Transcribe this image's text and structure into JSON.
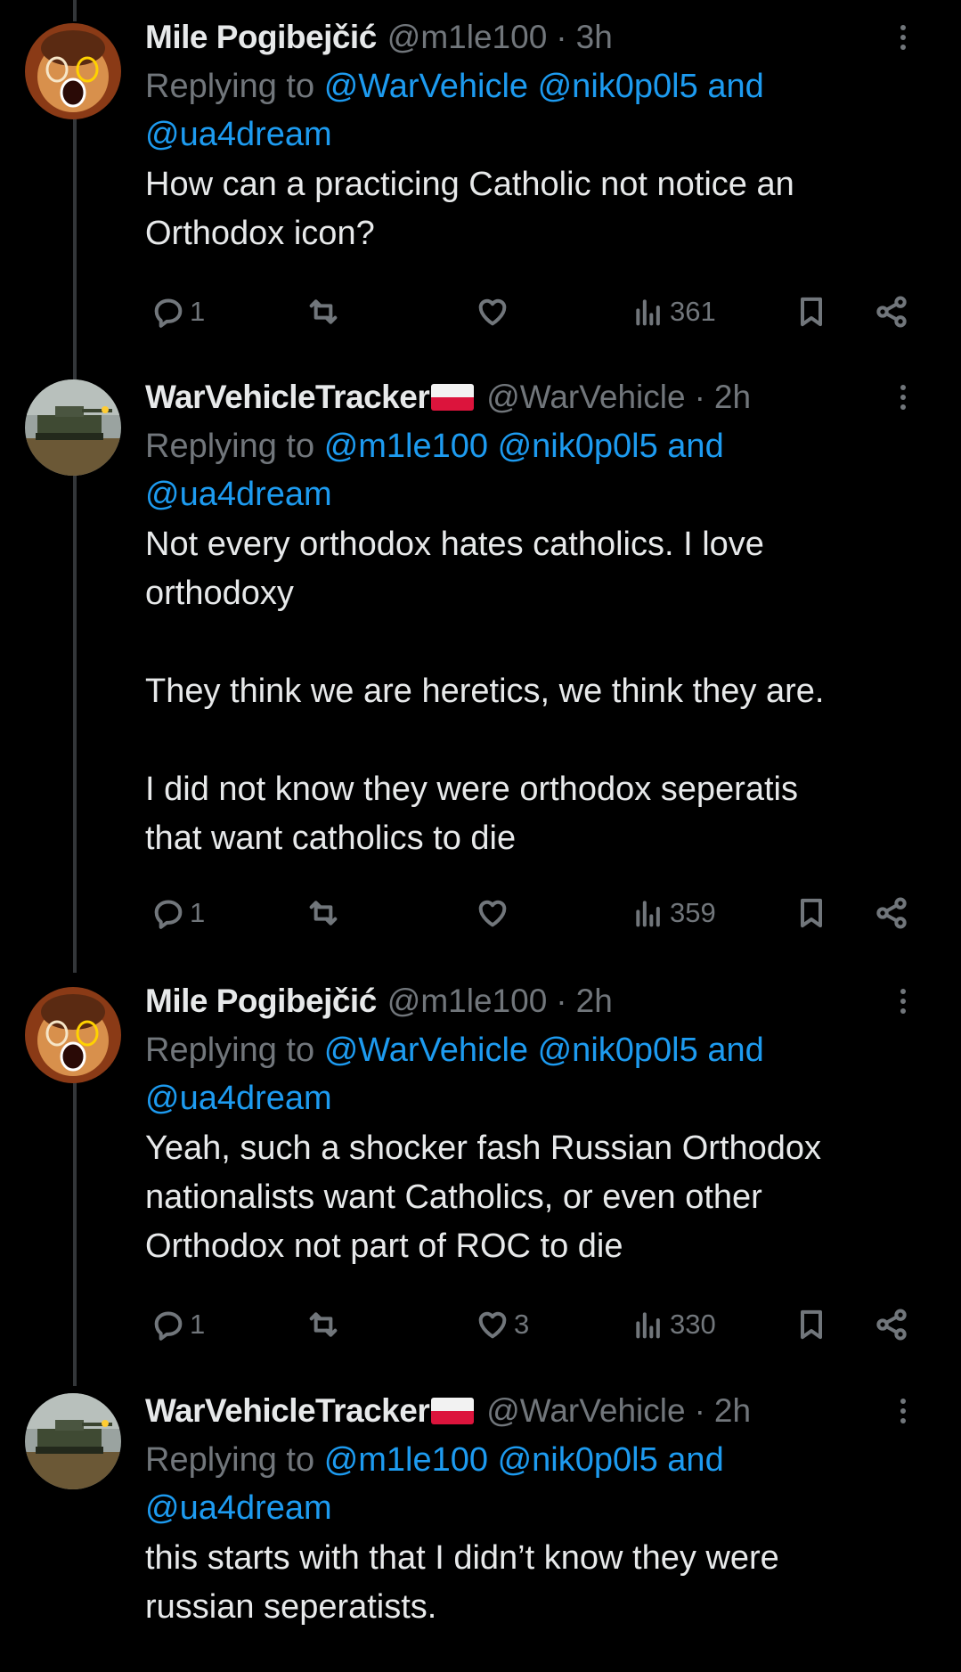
{
  "tweets": [
    {
      "name": "Mile Pogibejčić",
      "has_flag": false,
      "handle": "@m1le100",
      "time": "3h",
      "replying_prefix": "Replying to",
      "mention_1": "@WarVehicle",
      "mention_2": "@nik0p0l5",
      "and_text": "and",
      "mention_3": "@ua4dream",
      "body": [
        "How can a practicing Catholic not notice an",
        "Orthodox icon?"
      ],
      "replies": "1",
      "retweets": "",
      "likes": "",
      "views": "361"
    },
    {
      "name": "WarVehicleTracker",
      "has_flag": true,
      "handle": "@WarVehicle",
      "time": "2h",
      "replying_prefix": "Replying to",
      "mention_1": "@m1le100",
      "mention_2": "@nik0p0l5",
      "and_text": "and",
      "mention_3": "@ua4dream",
      "body": [
        "Not every orthodox hates catholics. I love",
        "orthodoxy",
        "",
        "They think we are heretics, we think they are.",
        "",
        "I did not know they were orthodox seperatis",
        "that want catholics to die"
      ],
      "replies": "1",
      "retweets": "",
      "likes": "",
      "views": "359"
    },
    {
      "name": "Mile Pogibejčić",
      "has_flag": false,
      "handle": "@m1le100",
      "time": "2h",
      "replying_prefix": "Replying to",
      "mention_1": "@WarVehicle",
      "mention_2": "@nik0p0l5",
      "and_text": "and",
      "mention_3": "@ua4dream",
      "body": [
        "Yeah, such a shocker fash Russian Orthodox",
        "nationalists want Catholics, or even other",
        "Orthodox not part of ROC to die"
      ],
      "replies": "1",
      "retweets": "",
      "likes": "3",
      "views": "330"
    },
    {
      "name": "WarVehicleTracker",
      "has_flag": true,
      "handle": "@WarVehicle",
      "time": "2h",
      "replying_prefix": "Replying to",
      "mention_1": "@m1le100",
      "mention_2": "@nik0p0l5",
      "and_text": "and",
      "mention_3": "@ua4dream",
      "body": [
        "this starts with that I didn’t know they were",
        "russian seperatists."
      ]
    }
  ],
  "colors": {
    "background": "#000000",
    "text": "#e7e9ea",
    "secondary": "#71767b",
    "link": "#1d9bf0",
    "thread_line": "#333639",
    "flag_white": "#f2f2f2",
    "flag_red": "#dc143c"
  },
  "icons": {
    "reply": "reply-icon",
    "retweet": "retweet-icon",
    "like": "heart-icon",
    "views": "views-icon",
    "bookmark": "bookmark-icon",
    "share": "share-icon",
    "more": "more-options-icon",
    "flag": "poland-flag-icon"
  }
}
